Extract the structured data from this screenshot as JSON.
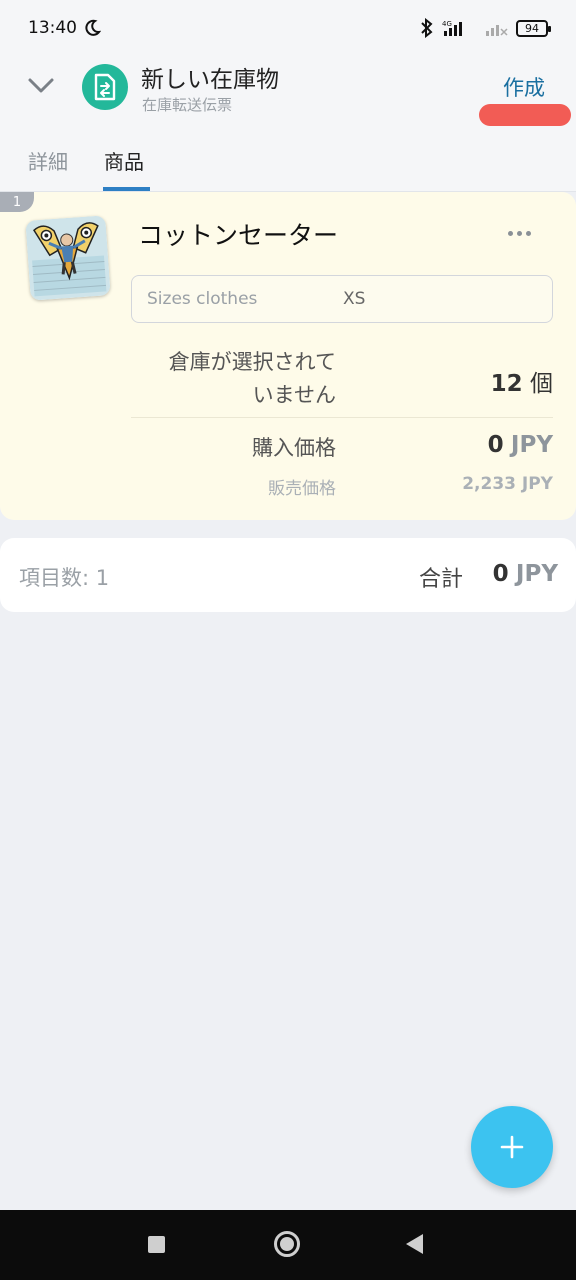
{
  "status_bar": {
    "time": "13:40",
    "battery": "94"
  },
  "header": {
    "title": "新しい在庫物",
    "subtitle": "在庫転送伝票",
    "create_label": "作成"
  },
  "tabs": [
    {
      "label": "詳細"
    },
    {
      "label": "商品"
    }
  ],
  "item": {
    "index": "1",
    "name": "コットンセーター",
    "size_placeholder": "Sizes clothes",
    "size_value": "XS",
    "warehouse_label_line1": "倉庫が選択されて",
    "warehouse_label_line2": "いません",
    "quantity_value": "12",
    "quantity_unit": "個",
    "purchase_label": "購入価格",
    "purchase_value": "0",
    "purchase_currency": "JPY",
    "sale_label": "販売価格",
    "sale_value": "2,233 JPY"
  },
  "summary": {
    "count_text": "項目数: 1",
    "total_label": "合計",
    "total_value": "0",
    "total_currency": "JPY"
  },
  "colors": {
    "accent": "#2d7fc4",
    "fab": "#3cc3f0",
    "card_bg": "#fefbe9",
    "doc_icon_bg": "#23b89a"
  },
  "icons": [
    "moon-icon",
    "bluetooth-icon",
    "signal-icon",
    "battery-icon",
    "chevron-down-icon",
    "document-transfer-icon",
    "more-icon",
    "plus-icon",
    "recent-apps-icon",
    "home-icon",
    "back-icon"
  ]
}
